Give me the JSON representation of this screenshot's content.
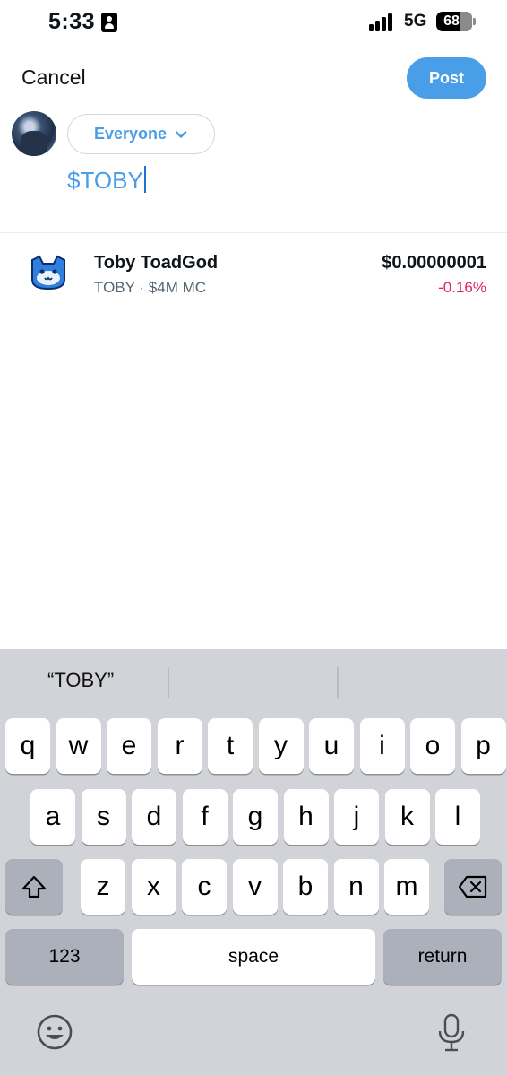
{
  "status_bar": {
    "time": "5:33",
    "network": "5G",
    "battery": "68",
    "battery_level": 0.68
  },
  "header": {
    "cancel_label": "Cancel",
    "post_label": "Post"
  },
  "composer": {
    "audience_label": "Everyone",
    "text": "$TOBY"
  },
  "suggestion": {
    "name": "Toby ToadGod",
    "meta": "TOBY · $4M MC",
    "price": "$0.00000001",
    "change": "-0.16%",
    "change_color": "#e0245e"
  },
  "keyboard": {
    "prediction": "“TOBY”",
    "row1": [
      "q",
      "w",
      "e",
      "r",
      "t",
      "y",
      "u",
      "i",
      "o",
      "p"
    ],
    "row2": [
      "a",
      "s",
      "d",
      "f",
      "g",
      "h",
      "j",
      "k",
      "l"
    ],
    "row3": [
      "z",
      "x",
      "c",
      "v",
      "b",
      "n",
      "m"
    ],
    "numbers_label": "123",
    "space_label": "space",
    "return_label": "return"
  },
  "colors": {
    "accent": "#4a9ee8",
    "keyboard_bg": "#d1d3d9"
  },
  "icons": [
    "id-card-icon",
    "signal-icon",
    "battery-icon",
    "chevron-down-icon",
    "shift-icon",
    "backspace-icon",
    "emoji-icon",
    "mic-icon",
    "token-logo-icon"
  ]
}
